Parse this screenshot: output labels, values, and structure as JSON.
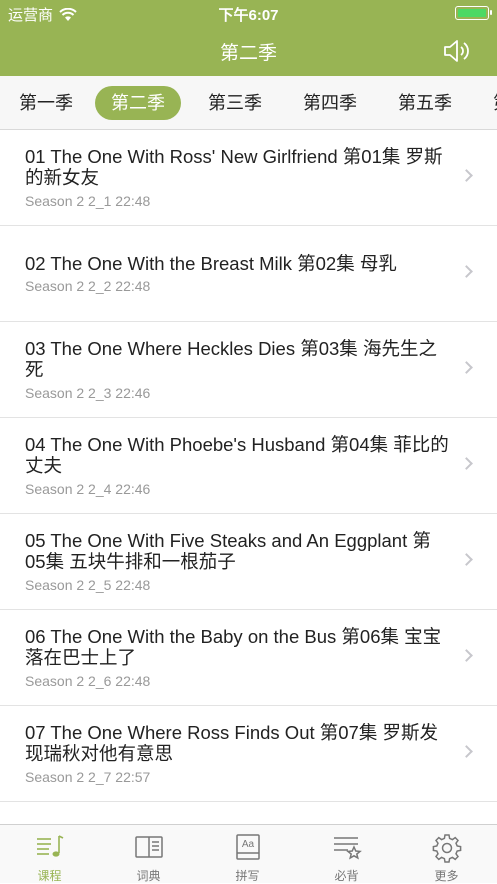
{
  "status_bar": {
    "carrier": "运营商",
    "time": "下午6:07"
  },
  "nav": {
    "title": "第二季"
  },
  "season_tabs": [
    "第一季",
    "第二季",
    "第三季",
    "第四季",
    "第五季",
    "第"
  ],
  "active_tab_index": 1,
  "episodes": [
    {
      "title": "01 The One With Ross' New Girlfriend 第01集 罗斯的新女友",
      "sub": "Season 2  2_1  22:48"
    },
    {
      "title": "02 The One With the Breast Milk 第02集 母乳",
      "sub": "Season 2  2_2  22:48"
    },
    {
      "title": "03 The One Where Heckles Dies 第03集 海先生之死",
      "sub": "Season 2  2_3  22:46"
    },
    {
      "title": "04 The One With Phoebe's Husband 第04集 菲比的丈夫",
      "sub": "Season 2  2_4  22:46"
    },
    {
      "title": "05 The One With Five Steaks and An Eggplant 第05集 五块牛排和一根茄子",
      "sub": "Season 2  2_5  22:48"
    },
    {
      "title": "06 The One With the Baby on the Bus 第06集 宝宝落在巴士上了",
      "sub": "Season 2  2_6  22:48"
    },
    {
      "title": "07 The One Where Ross Finds Out 第07集 罗斯发现瑞秋对他有意思",
      "sub": "Season 2  2_7  22:57"
    }
  ],
  "tab_bar": [
    {
      "label": "课程",
      "icon": "course-icon"
    },
    {
      "label": "词典",
      "icon": "dictionary-icon"
    },
    {
      "label": "拼写",
      "icon": "spelling-icon"
    },
    {
      "label": "必背",
      "icon": "must-memorize-icon"
    },
    {
      "label": "更多",
      "icon": "gear-icon"
    }
  ],
  "active_bottom_tab_index": 0,
  "colors": {
    "accent": "#98b454",
    "battery": "#4cd964"
  }
}
